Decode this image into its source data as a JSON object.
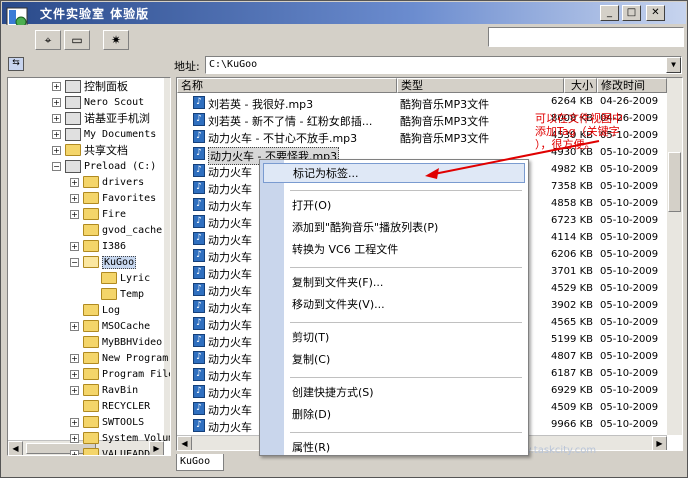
{
  "window": {
    "title": "文件实验室  体验版",
    "min_icon": "minimize-icon",
    "max_icon": "maximize-icon",
    "close_icon": "close-icon"
  },
  "toolbar": {
    "buttons": [
      {
        "icon": "crosshair-icon",
        "glyph": "⌖"
      },
      {
        "icon": "folder-icon",
        "glyph": "▭"
      },
      {
        "icon": "settings-icon",
        "glyph": "✷"
      }
    ],
    "search_value": ""
  },
  "address": {
    "label": "地址:",
    "path": "C:\\KuGoo"
  },
  "tree": {
    "items": [
      {
        "label": "控制面板",
        "level": 0,
        "exp": "+",
        "icon": "control-panel-icon"
      },
      {
        "label": "Nero Scout",
        "level": 0,
        "exp": "+",
        "icon": "nero-icon"
      },
      {
        "label": "诺基亚手机浏",
        "level": 0,
        "exp": "+",
        "icon": "phone-icon"
      },
      {
        "label": "My Documents",
        "level": 0,
        "exp": "+",
        "icon": "documents-icon"
      },
      {
        "label": "共享文档",
        "level": 0,
        "exp": "+",
        "icon": "folder-icon"
      },
      {
        "label": "Preload (C:)",
        "level": 0,
        "exp": "−",
        "icon": "drive-icon"
      },
      {
        "label": "drivers",
        "level": 1,
        "exp": "+",
        "icon": "folder-icon"
      },
      {
        "label": "Favorites",
        "level": 1,
        "exp": "+",
        "icon": "folder-icon"
      },
      {
        "label": "Fire",
        "level": 1,
        "exp": "+",
        "icon": "folder-icon"
      },
      {
        "label": "gvod_cache",
        "level": 1,
        "exp": "",
        "icon": "folder-icon"
      },
      {
        "label": "I386",
        "level": 1,
        "exp": "+",
        "icon": "folder-icon"
      },
      {
        "label": "KuGoo",
        "level": 1,
        "exp": "−",
        "icon": "folder-open-icon"
      },
      {
        "label": "Lyric",
        "level": 2,
        "exp": "",
        "icon": "folder-icon"
      },
      {
        "label": "Temp",
        "level": 2,
        "exp": "",
        "icon": "folder-icon"
      },
      {
        "label": "Log",
        "level": 1,
        "exp": "",
        "icon": "folder-icon"
      },
      {
        "label": "MSOCache",
        "level": 1,
        "exp": "+",
        "icon": "folder-icon"
      },
      {
        "label": "MyBBHVideo",
        "level": 1,
        "exp": "",
        "icon": "folder-icon"
      },
      {
        "label": "New Program",
        "level": 1,
        "exp": "+",
        "icon": "folder-icon"
      },
      {
        "label": "Program Files",
        "level": 1,
        "exp": "+",
        "icon": "folder-icon"
      },
      {
        "label": "RavBin",
        "level": 1,
        "exp": "+",
        "icon": "folder-icon"
      },
      {
        "label": "RECYCLER",
        "level": 1,
        "exp": "",
        "icon": "folder-icon"
      },
      {
        "label": "SWTOOLS",
        "level": 1,
        "exp": "+",
        "icon": "folder-icon"
      },
      {
        "label": "System Volume",
        "level": 1,
        "exp": "+",
        "icon": "folder-icon"
      },
      {
        "label": "VALUEADD",
        "level": 1,
        "exp": "+",
        "icon": "folder-icon"
      }
    ]
  },
  "list": {
    "headers": {
      "name": "名称",
      "type": "类型",
      "size": "大小",
      "modified": "修改时间"
    },
    "rows": [
      {
        "name": "刘若英 - 我很好.mp3",
        "type": "酷狗音乐MP3文件",
        "size": "6264 KB",
        "date": "04-26-2009"
      },
      {
        "name": "刘若英 - 新不了情 - 红粉女郎插...",
        "type": "酷狗音乐MP3文件",
        "size": "8008 KB",
        "date": "04-26-2009"
      },
      {
        "name": "动力火车 - 不甘心不放手.mp3",
        "type": "酷狗音乐MP3文件",
        "size": "4530 KB",
        "date": "05-10-2009"
      },
      {
        "name": "动力火车 - 不要怪我.mp3",
        "type": "",
        "size": "4930 KB",
        "date": "05-10-2009"
      },
      {
        "name": "动力火车",
        "type": "",
        "size": "4982 KB",
        "date": "05-10-2009"
      },
      {
        "name": "动力火车",
        "type": "",
        "size": "7358 KB",
        "date": "05-10-2009"
      },
      {
        "name": "动力火车",
        "type": "",
        "size": "4858 KB",
        "date": "05-10-2009"
      },
      {
        "name": "动力火车",
        "type": "",
        "size": "6723 KB",
        "date": "05-10-2009"
      },
      {
        "name": "动力火车",
        "type": "",
        "size": "4114 KB",
        "date": "05-10-2009"
      },
      {
        "name": "动力火车",
        "type": "",
        "size": "6206 KB",
        "date": "05-10-2009"
      },
      {
        "name": "动力火车",
        "type": "",
        "size": "3701 KB",
        "date": "05-10-2009"
      },
      {
        "name": "动力火车",
        "type": "",
        "size": "4529 KB",
        "date": "05-10-2009"
      },
      {
        "name": "动力火车",
        "type": "",
        "size": "3902 KB",
        "date": "05-10-2009"
      },
      {
        "name": "动力火车",
        "type": "",
        "size": "4565 KB",
        "date": "05-10-2009"
      },
      {
        "name": "动力火车",
        "type": "",
        "size": "5199 KB",
        "date": "05-10-2009"
      },
      {
        "name": "动力火车",
        "type": "",
        "size": "4807 KB",
        "date": "05-10-2009"
      },
      {
        "name": "动力火车",
        "type": "",
        "size": "6187 KB",
        "date": "05-10-2009"
      },
      {
        "name": "动力火车",
        "type": "",
        "size": "6929 KB",
        "date": "05-10-2009"
      },
      {
        "name": "动力火车",
        "type": "",
        "size": "4509 KB",
        "date": "05-10-2009"
      },
      {
        "name": "动力火车",
        "type": "",
        "size": "9966 KB",
        "date": "05-10-2009"
      }
    ]
  },
  "context_menu": {
    "items": [
      {
        "label": "标记为标签...",
        "hover": true
      },
      {
        "sep": true
      },
      {
        "label": "打开(O)"
      },
      {
        "label": "添加到\"酷狗音乐\"播放列表(P)"
      },
      {
        "label": "转换为 VC6 工程文件"
      },
      {
        "sep": true
      },
      {
        "label": "复制到文件夹(F)..."
      },
      {
        "label": "移动到文件夹(V)..."
      },
      {
        "sep": true
      },
      {
        "label": "剪切(T)"
      },
      {
        "label": "复制(C)"
      },
      {
        "sep": true
      },
      {
        "label": "创建快捷方式(S)"
      },
      {
        "label": "删除(D)"
      },
      {
        "sep": true
      },
      {
        "label": "属性(R)"
      }
    ]
  },
  "annotation": {
    "line1": "可以在文件视图中",
    "line2": "添加Tag（关键字",
    "line3": "），很方便。",
    "color": "#e00000"
  },
  "tabs": [
    {
      "label": "KuGoo"
    }
  ],
  "watermark": "www.taskcity.com"
}
